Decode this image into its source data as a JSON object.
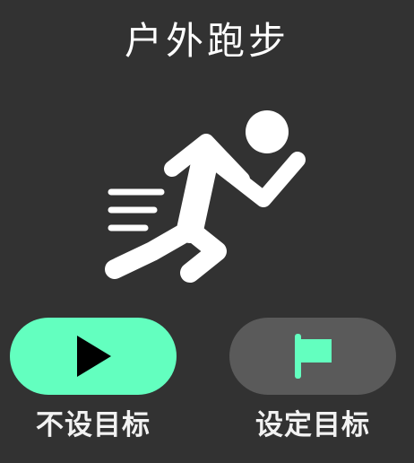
{
  "header": {
    "title": "户外跑步"
  },
  "workout": {
    "icon": "running-person-icon"
  },
  "actions": {
    "no_goal": {
      "icon": "play-icon",
      "label": "不设目标",
      "color": "#63ffbf"
    },
    "set_goal": {
      "icon": "flag-icon",
      "label": "设定目标",
      "color": "#5a5a5a",
      "icon_color": "#63ffbf"
    }
  },
  "colors": {
    "background": "#323232",
    "text": "#ffffff"
  }
}
